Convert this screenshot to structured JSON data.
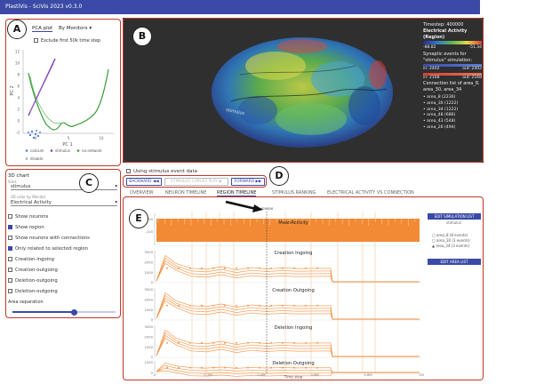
{
  "app": {
    "title": "PlastiVis - SciVis 2023 v0.3.0"
  },
  "markers": {
    "a": "A",
    "b": "B",
    "c": "C",
    "d": "D",
    "e": "E"
  },
  "pca": {
    "plot_label": "PCA plot",
    "mode_label": "By Monitors",
    "exclude_label": "Exclude first 50k time step",
    "y_ticks": [
      "12",
      "10",
      "8",
      "6",
      "4",
      "2",
      "0",
      "-2"
    ],
    "x_ticks": [
      "0",
      "5",
      "10"
    ],
    "xlabel": "PC 1",
    "ylabel": "PC 2",
    "legend": [
      "calcium",
      "stimulus",
      "no-network",
      "disable"
    ],
    "legend_colors": [
      "#5b7fd6",
      "#7a3fb0",
      "#3a9a3a",
      "#aaaaaa"
    ]
  },
  "brain": {
    "timestep": "Timestep: 400000",
    "activity_title": "Electrical Activity (Region)",
    "scale_min": "-88.82",
    "scale_max": "-51.34",
    "syn_text_1": "Synaptic events for",
    "syn_text_2": "\"stimulus\" simulation:",
    "in_1": "in: 2402",
    "out_1": "out: 2402",
    "in_2": "in: 2168",
    "out_2": "out: 2168",
    "conn_title": "Connection list of area_8,",
    "conn_sub": "area_30, area_34",
    "connections": [
      "area_8 (2236)",
      "area_30 (1222)",
      "area_34 (1222)",
      "area_48 (686)",
      "area_43 (548)",
      "area_26 (494)"
    ],
    "stimulus_label": "stimulus"
  },
  "controls": {
    "chart_title": "3D chart",
    "sim_label": "Sims",
    "sim_value": "stimulus",
    "color_label": "3D color by Monitor",
    "color_value": "Electrical Activity",
    "options": [
      {
        "label": "Show neurons",
        "checked": false
      },
      {
        "label": "Show region",
        "checked": true
      },
      {
        "label": "Show neurons with connections",
        "checked": false
      },
      {
        "label": "Only related to selected region",
        "checked": true
      },
      {
        "label": "Creation-ingoing",
        "checked": false
      },
      {
        "label": "Creation-outgoing",
        "checked": false
      },
      {
        "label": "Deletion-outgoing",
        "checked": false
      },
      {
        "label": "Deletion-outgoing",
        "checked": false
      }
    ],
    "separation_label": "Area separation",
    "separation_value": 0.6
  },
  "player": {
    "using_label": "Using stimulus event data",
    "backward": "BACKWARD ◀◀",
    "curves_play": "STIMULUS CURVES PLAY ▶",
    "forward": "FORWARD ▶▶"
  },
  "tabs": [
    "OVERVIEW",
    "NEURON TIMELINE",
    "REGION TIMELINE",
    "STIMULUS RANKING",
    "ELECTRICAL ACTIVITY VS CONNECTION"
  ],
  "active_tab": 2,
  "timeline": {
    "marker_label": "400000",
    "charts": [
      "MeanActivity",
      "Creation Ingoing",
      "Creation Outgoing",
      "Deletion Ingoing",
      "Deletion Outgoing"
    ],
    "x_ticks": [
      "0",
      "0.2M",
      "0.4M",
      "0.6M",
      "0.8M",
      "1M"
    ],
    "xlabel": "Time step",
    "y_ticks_activity": [
      "-50",
      "-100"
    ],
    "y_ticks_counts": [
      "3000",
      "2000",
      "1000",
      "0"
    ],
    "edit_sim_button": "EDIT SIMULATION LIST",
    "sim_sub": "stimulus",
    "edit_area_button": "EDIT AREA LIST",
    "areas": [
      "area_8 (8 events)",
      "area_30 (3 events)",
      "area_34 (3 events)"
    ]
  },
  "colors": {
    "accent": "#3b4aa6",
    "orange": "#f28a35",
    "panel_border": "#c0392b"
  }
}
